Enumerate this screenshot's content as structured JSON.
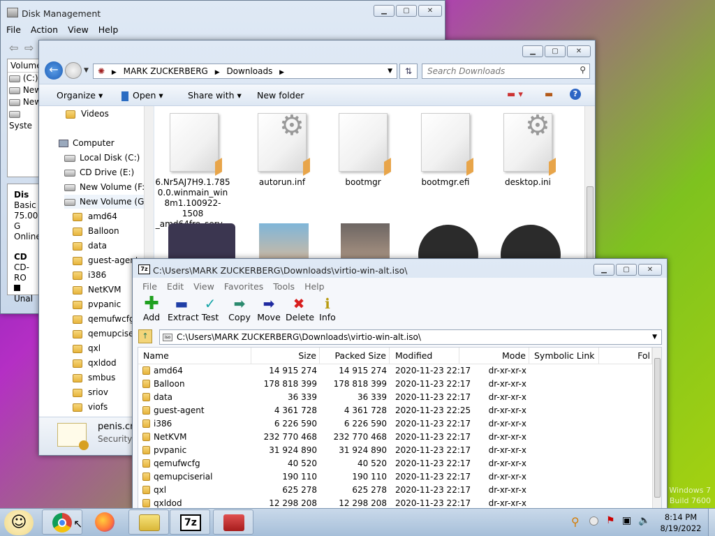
{
  "disk_mgmt": {
    "title": "Disk Management",
    "menu": [
      "File",
      "Action",
      "View",
      "Help"
    ],
    "volume_header": "Volume",
    "volumes": [
      "(C:)",
      "New",
      "New",
      "Syste"
    ],
    "disk_label": "Dis",
    "disk_type": "Basic",
    "disk_size": "75.00 G",
    "disk_status": "Online",
    "cd_label": "CD",
    "cd_sub": "CD-RO",
    "unalloc": "Unal"
  },
  "explorer": {
    "breadcrumb": [
      "MARK ZUCKERBERG",
      "Downloads"
    ],
    "search_placeholder": "Search Downloads",
    "toolbar": {
      "organize": "Organize",
      "open": "Open",
      "share": "Share with",
      "new_folder": "New folder"
    },
    "tree": [
      {
        "label": "Videos",
        "type": "folder"
      },
      {
        "label": "Computer",
        "type": "computer"
      },
      {
        "label": "Local Disk (C:)",
        "type": "drive"
      },
      {
        "label": "CD Drive (E:)",
        "type": "drive"
      },
      {
        "label": "New Volume (F:)",
        "type": "drive"
      },
      {
        "label": "New Volume (G:)",
        "type": "drive"
      },
      {
        "label": "amd64",
        "type": "folder"
      },
      {
        "label": "Balloon",
        "type": "folder"
      },
      {
        "label": "data",
        "type": "folder"
      },
      {
        "label": "guest-agent",
        "type": "folder"
      },
      {
        "label": "i386",
        "type": "folder"
      },
      {
        "label": "NetKVM",
        "type": "folder"
      },
      {
        "label": "pvpanic",
        "type": "folder"
      },
      {
        "label": "qemufwcfg",
        "type": "folder"
      },
      {
        "label": "qemupciseri",
        "type": "folder"
      },
      {
        "label": "qxl",
        "type": "folder"
      },
      {
        "label": "qxldod",
        "type": "folder"
      },
      {
        "label": "smbus",
        "type": "folder"
      },
      {
        "label": "sriov",
        "type": "folder"
      },
      {
        "label": "viofs",
        "type": "folder"
      }
    ],
    "files": [
      {
        "name": "6.Nr5AJ7H9.1.7850.0.winmain_win8m1.100922-1508_amd64fre_serv...",
        "lines": [
          "6.Nr5AJ7H9.1.785",
          "0.0.winmain_win",
          "8m1.100922-1508",
          "_amd64fre_serv..."
        ],
        "icon": "document-icon"
      },
      {
        "name": "autorun.inf",
        "lines": [
          "autorun.inf"
        ],
        "icon": "settings-file-icon"
      },
      {
        "name": "bootmgr",
        "lines": [
          "bootmgr"
        ],
        "icon": "document-icon"
      },
      {
        "name": "bootmgr.efi",
        "lines": [
          "bootmgr.efi"
        ],
        "icon": "document-icon"
      },
      {
        "name": "desktop.ini",
        "lines": [
          "desktop.ini"
        ],
        "icon": "settings-file-icon"
      }
    ],
    "details_name": "penis.crt",
    "details_type": "Security C"
  },
  "sevenzip": {
    "title": "C:\\Users\\MARK ZUCKERBERG\\Downloads\\virtio-win-alt.iso\\",
    "menu": [
      "File",
      "Edit",
      "View",
      "Favorites",
      "Tools",
      "Help"
    ],
    "toolbar": [
      "Add",
      "Extract",
      "Test",
      "Copy",
      "Move",
      "Delete",
      "Info"
    ],
    "path": "C:\\Users\\MARK ZUCKERBERG\\Downloads\\virtio-win-alt.iso\\",
    "columns": [
      "Name",
      "Size",
      "Packed Size",
      "Modified",
      "Mode",
      "Symbolic Link",
      "Fol"
    ],
    "rows": [
      [
        "amd64",
        "14 915 274",
        "14 915 274",
        "2020-11-23 22:17",
        "dr-xr-xr-x"
      ],
      [
        "Balloon",
        "178 818 399",
        "178 818 399",
        "2020-11-23 22:17",
        "dr-xr-xr-x"
      ],
      [
        "data",
        "36 339",
        "36 339",
        "2020-11-23 22:17",
        "dr-xr-xr-x"
      ],
      [
        "guest-agent",
        "4 361 728",
        "4 361 728",
        "2020-11-23 22:25",
        "dr-xr-xr-x"
      ],
      [
        "i386",
        "6 226 590",
        "6 226 590",
        "2020-11-23 22:17",
        "dr-xr-xr-x"
      ],
      [
        "NetKVM",
        "232 770 468",
        "232 770 468",
        "2020-11-23 22:17",
        "dr-xr-xr-x"
      ],
      [
        "pvpanic",
        "31 924 890",
        "31 924 890",
        "2020-11-23 22:17",
        "dr-xr-xr-x"
      ],
      [
        "qemufwcfg",
        "40 520",
        "40 520",
        "2020-11-23 22:17",
        "dr-xr-xr-x"
      ],
      [
        "qemupciserial",
        "190 110",
        "190 110",
        "2020-11-23 22:17",
        "dr-xr-xr-x"
      ],
      [
        "qxl",
        "625 278",
        "625 278",
        "2020-11-23 22:17",
        "dr-xr-xr-x"
      ],
      [
        "qxldod",
        "12 298 208",
        "12 298 208",
        "2020-11-23 22:17",
        "dr-xr-xr-x"
      ]
    ]
  },
  "watermark": [
    "Windows 7",
    "Build 7600"
  ],
  "taskbar": {
    "time": "8:14 PM",
    "date": "8/19/2022",
    "zip_label": "7z"
  }
}
